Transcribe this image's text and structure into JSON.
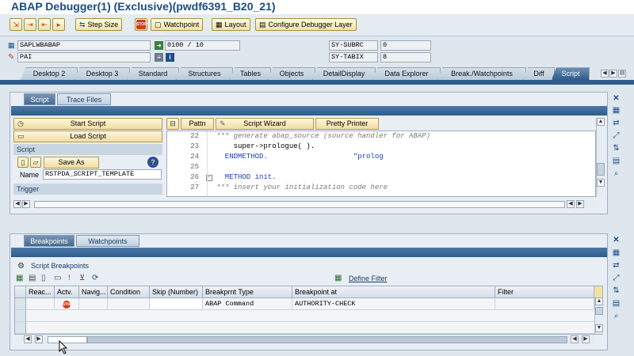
{
  "window": {
    "title": "ABAP Debugger(1)  (Exclusive)(pwdf6391_B20_21)"
  },
  "toolbar": {
    "step_size": "Step Size",
    "watchpoint": "Watchpoint",
    "layout": "Layout",
    "configure": "Configure Debugger Layer"
  },
  "status": {
    "program": "SAPLWBABAP",
    "event": "PAI",
    "line": "0100 / 10",
    "sy_subrc_label": "SY-SUBRC",
    "sy_subrc_value": "0",
    "sy_tabix_label": "SY-TABIX",
    "sy_tabix_value": "8"
  },
  "desktop_tabs": [
    "Desktop 2",
    "Desktop 3",
    "Standard",
    "Structures",
    "Tables",
    "Objects",
    "DetailDisplay",
    "Data Explorer",
    "Break./Watchpoints",
    "Diff",
    "Script"
  ],
  "script_panel": {
    "tabs": [
      "Script",
      "Trace Files"
    ],
    "start_script": "Start Script",
    "load_script": "Load Script",
    "script_group": "Script",
    "save_as": "Save As",
    "name_label": "Name",
    "name_value": "RSTPDA_SCRIPT_TEMPLATE",
    "trigger_group": "Trigger",
    "pattn": "Pattn",
    "script_wizard": "Script Wizard",
    "pretty_printer": "Pretty Printer"
  },
  "code_lines": [
    {
      "no": "22",
      "text": "*** generate abap_source (source handler for ABAP)",
      "kind": "comment"
    },
    {
      "no": "23",
      "text": "    super->prologue( ).",
      "kind": "code"
    },
    {
      "no": "24",
      "text": "  ENDMETHOD.                    \"prolog",
      "kind": "keyword"
    },
    {
      "no": "25",
      "text": "",
      "kind": "code"
    },
    {
      "no": "26",
      "text": "  METHOD init.",
      "kind": "keyword"
    },
    {
      "no": "27",
      "text": "*** insert your initialization code here",
      "kind": "comment"
    }
  ],
  "bp_panel": {
    "tabs": [
      "Breakpoints",
      "Watchpoints"
    ],
    "script_breakpoints": "Script Breakpoints",
    "define_filter": "Define Filter",
    "columns": [
      "Reac...",
      "Actv.",
      "Navig...",
      "Condition",
      "Skip (Number)",
      "Breakprnt Type",
      "Breakpoint at",
      "Filter"
    ],
    "rows": [
      {
        "reac": "",
        "actv": "STOP",
        "navig": "",
        "condition": "",
        "skip": "",
        "type": "ABAP Command",
        "at": "AUTHORITY-CHECK",
        "filter": ""
      }
    ]
  },
  "colors": {
    "title": "#1b4b82",
    "accent_tab": "#2f5c8a",
    "keyword": "#1a3ec8",
    "stop": "#d43d1a"
  }
}
